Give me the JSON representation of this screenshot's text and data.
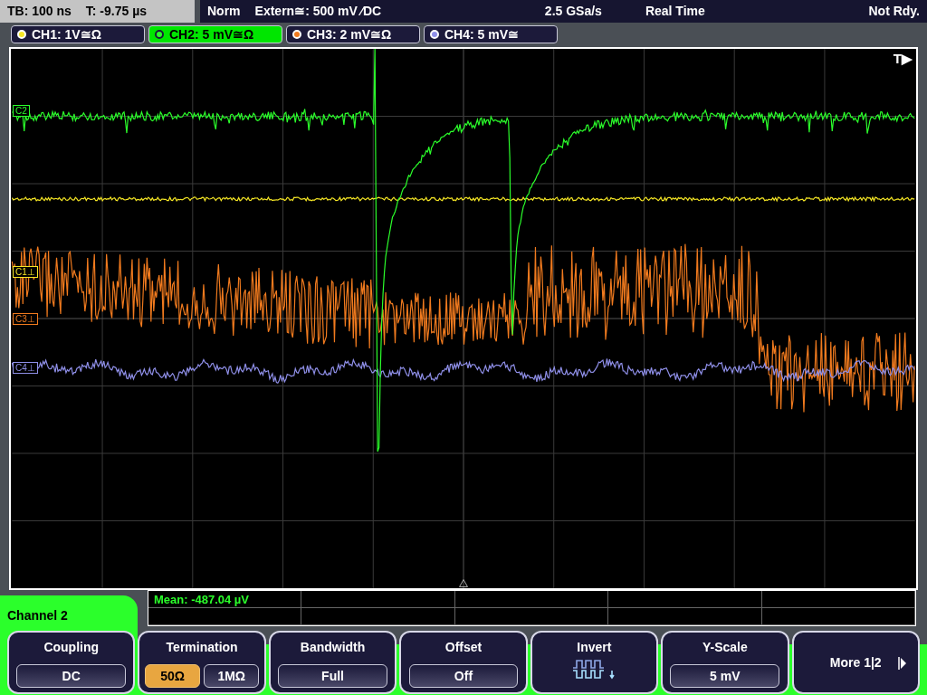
{
  "status_bar": {
    "timebase": "TB: 100 ns",
    "trigger_time": "T: -9.75 µs",
    "mode": "Norm",
    "trigger_source": "Extern≅: 500 mV ⁄DC",
    "sample_rate": "2.5 GSa/s",
    "acquisition": "Real Time",
    "state": "Not Rdy."
  },
  "channels": [
    {
      "label": "CH1: 1V≅Ω",
      "color": "#f5e625",
      "selected": false
    },
    {
      "label": "CH2: 5 mV≅Ω",
      "color": "#2bff2b",
      "selected": true
    },
    {
      "label": "CH3: 2 mV≅Ω",
      "color": "#f07a1e",
      "selected": false
    },
    {
      "label": "CH4: 5 mV≅",
      "color": "#8f8fe8",
      "selected": false
    }
  ],
  "scope": {
    "trigger_label": "T▶",
    "markers": [
      {
        "label": "C2",
        "color": "#2bff2b"
      },
      {
        "label": "C1⊥",
        "color": "#f5e625"
      },
      {
        "label": "C3⊥",
        "color": "#f07a1e"
      },
      {
        "label": "C4⊥",
        "color": "#8f8fe8"
      }
    ]
  },
  "measurement": {
    "mean": "Mean: -487.04 µV"
  },
  "menu": {
    "title": "Channel 2",
    "buttons": [
      {
        "kind": "choice",
        "title": "Coupling",
        "value": "DC"
      },
      {
        "kind": "toggle",
        "title": "Termination",
        "options": [
          {
            "label": "50Ω",
            "selected": true
          },
          {
            "label": "1MΩ",
            "selected": false
          }
        ]
      },
      {
        "kind": "choice",
        "title": "Bandwidth",
        "value": "Full"
      },
      {
        "kind": "choice",
        "title": "Offset",
        "value": "Off"
      },
      {
        "kind": "icon",
        "title": "Invert"
      },
      {
        "kind": "choice",
        "title": "Y-Scale",
        "value": "5 mV"
      },
      {
        "kind": "more",
        "title": "More 1|2"
      }
    ]
  }
}
